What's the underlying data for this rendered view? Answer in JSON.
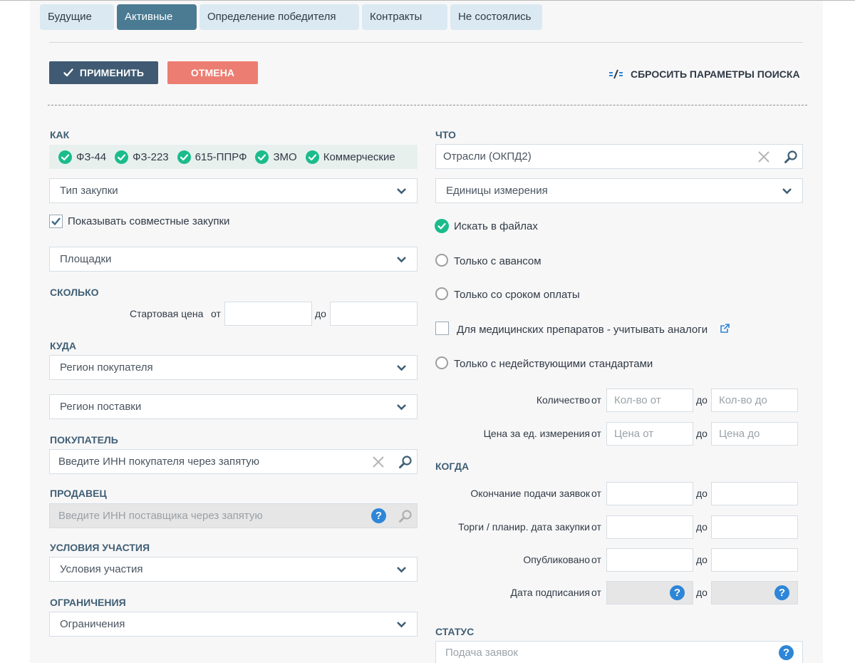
{
  "tabs": [
    {
      "label": "Будущие",
      "active": false
    },
    {
      "label": "Активные",
      "active": true
    },
    {
      "label": "Определение победителя",
      "active": false
    },
    {
      "label": "Контракты",
      "active": false
    },
    {
      "label": "Не состоялись",
      "active": false
    }
  ],
  "actions": {
    "apply_label": "ПРИМЕНИТЬ",
    "cancel_label": "ОТМЕНА",
    "reset_label": "СБРОСИТЬ ПАРАМЕТРЫ ПОИСКА"
  },
  "colors": {
    "accent": "#4a7b93",
    "apply_button": "#3f5a72",
    "cancel_button": "#ec7d72",
    "check_green": "#1abc8c",
    "help_blue": "#2d86d8"
  },
  "how": {
    "title": "КАК",
    "laws": [
      "ФЗ-44",
      "ФЗ-223",
      "615-ППРФ",
      "ЗМО",
      "Коммерческие"
    ],
    "purchase_type": "Тип закупки",
    "joint_label": "Показывать совместные закупки",
    "joint_checked": true,
    "platforms": "Площадки"
  },
  "how_much": {
    "title": "СКОЛЬКО",
    "start_price_label": "Стартовая цена",
    "from": "от",
    "to": "до"
  },
  "where": {
    "title": "КУДА",
    "buyer_region": "Регион покупателя",
    "delivery_region": "Регион поставки"
  },
  "buyer": {
    "title": "ПОКУПАТЕЛЬ",
    "placeholder": "Введите ИНН покупателя через запятую"
  },
  "seller": {
    "title": "ПРОДАВЕЦ",
    "placeholder": "Введите ИНН поставщика через запятую",
    "help": "?"
  },
  "conditions": {
    "title": "УСЛОВИЯ УЧАСТИЯ",
    "value": "Условия участия"
  },
  "restrictions": {
    "title": "ОГРАНИЧЕНИЯ",
    "value": "Ограничения"
  },
  "what": {
    "title": "ЧТО",
    "industries": "Отрасли (ОКПД2)",
    "units": "Единицы измерения",
    "search_files": "Искать в файлах",
    "advance_only": "Только с авансом",
    "payment_term_only": "Только со сроком оплаты",
    "medicine_analogs": "Для медицинских препаратов - учитывать аналоги",
    "invalid_standards": "Только с недействующими стандартами",
    "quantity_label": "Количество",
    "quantity_from": "Кол-во от",
    "quantity_to": "Кол-во до",
    "unit_price_label": "Цена за ед. измерения",
    "price_from": "Цена от",
    "price_to": "Цена до",
    "from": "от",
    "to": "до"
  },
  "when": {
    "title": "КОГДА",
    "deadline_label": "Окончание подачи заявок",
    "auction_label": "Торги / планир. дата закупки",
    "published_label": "Опубликовано",
    "signed_label": "Дата подписания",
    "from": "от",
    "to": "до",
    "help": "?"
  },
  "status": {
    "title": "СТАТУС",
    "placeholder": "Подача заявок",
    "help": "?"
  }
}
